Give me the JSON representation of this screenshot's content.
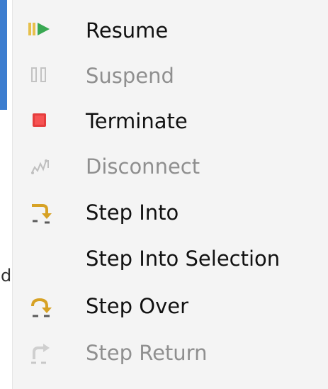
{
  "menu": {
    "items": [
      {
        "label": "Resume",
        "icon": "resume-icon",
        "enabled": true
      },
      {
        "label": "Suspend",
        "icon": "suspend-icon",
        "enabled": false
      },
      {
        "label": "Terminate",
        "icon": "terminate-icon",
        "enabled": true
      },
      {
        "label": "Disconnect",
        "icon": "disconnect-icon",
        "enabled": false
      },
      {
        "label": "Step Into",
        "icon": "step-into-icon",
        "enabled": true
      },
      {
        "label": "Step Into Selection",
        "icon": "",
        "enabled": true
      },
      {
        "label": "Step Over",
        "icon": "step-over-icon",
        "enabled": true
      },
      {
        "label": "Step Return",
        "icon": "step-return-icon",
        "enabled": false
      }
    ]
  },
  "background": {
    "partial_letter": "d"
  }
}
